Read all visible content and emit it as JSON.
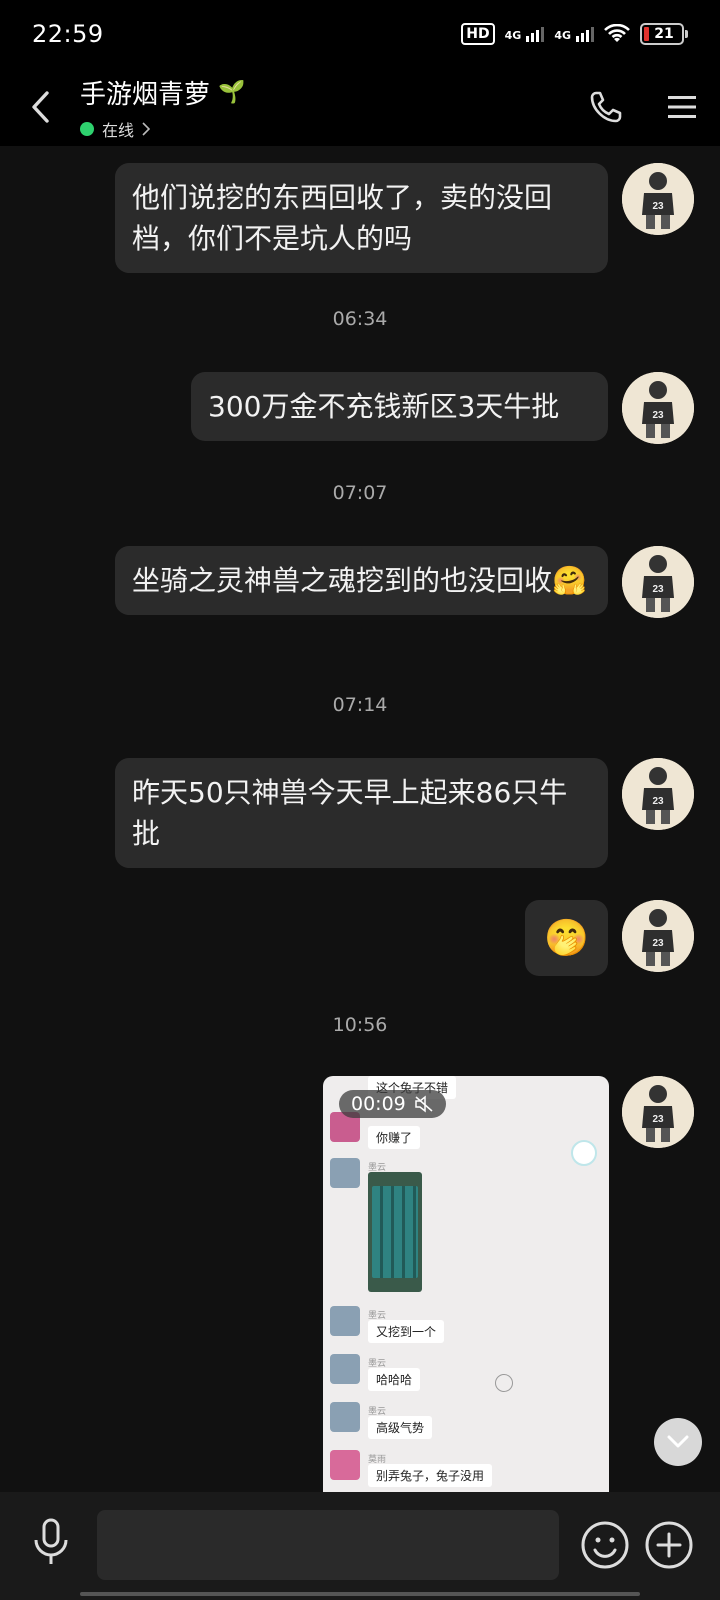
{
  "status_bar": {
    "time": "22:59",
    "hd_label": "HD",
    "network_1": "4G",
    "network_2": "4G",
    "battery_level": "21"
  },
  "header": {
    "title": "手游烟青萝",
    "title_emoji": "🌱",
    "status": "在线",
    "status_color": "#2ed16e",
    "back_icon": "chevron-left-icon",
    "call_icon": "phone-icon",
    "menu_icon": "menu-icon"
  },
  "messages": [
    {
      "type": "text",
      "text": "他们说挖的东西回收了，卖的没回档，你们不是坑人的吗"
    },
    {
      "type": "timestamp",
      "text": "06:34"
    },
    {
      "type": "text",
      "text": "300万金不充钱新区3天牛批"
    },
    {
      "type": "timestamp",
      "text": "07:07"
    },
    {
      "type": "text",
      "text": "坐骑之灵神兽之魂挖到的也没回收",
      "emoji": "🤗"
    },
    {
      "type": "timestamp",
      "text": "07:14"
    },
    {
      "type": "text",
      "text": "昨天50只神兽今天早上起来86只牛批"
    },
    {
      "type": "sticker",
      "emoji": "🤭"
    },
    {
      "type": "timestamp",
      "text": "10:56"
    },
    {
      "type": "video",
      "duration": "00:09",
      "muted": true
    }
  ],
  "video_content": {
    "messages": [
      {
        "text": "这个兔子不错"
      },
      {
        "text": "你赚了"
      },
      {
        "name": "墨云"
      },
      {
        "name": "墨云",
        "text": "又挖到一个"
      },
      {
        "name": "墨云",
        "text": "哈哈哈"
      },
      {
        "name": "墨云",
        "text": "高级气势"
      },
      {
        "name": "莫雨",
        "text": "别弄兔子，兔子没用"
      }
    ]
  },
  "input": {
    "placeholder": "",
    "voice_icon": "microphone-icon",
    "emoji_icon": "smiley-icon",
    "plus_icon": "plus-circle-icon"
  },
  "colors": {
    "background": "#111111",
    "bubble": "#2b2b2b",
    "header": "#000000",
    "accent": "#2ed16e"
  }
}
